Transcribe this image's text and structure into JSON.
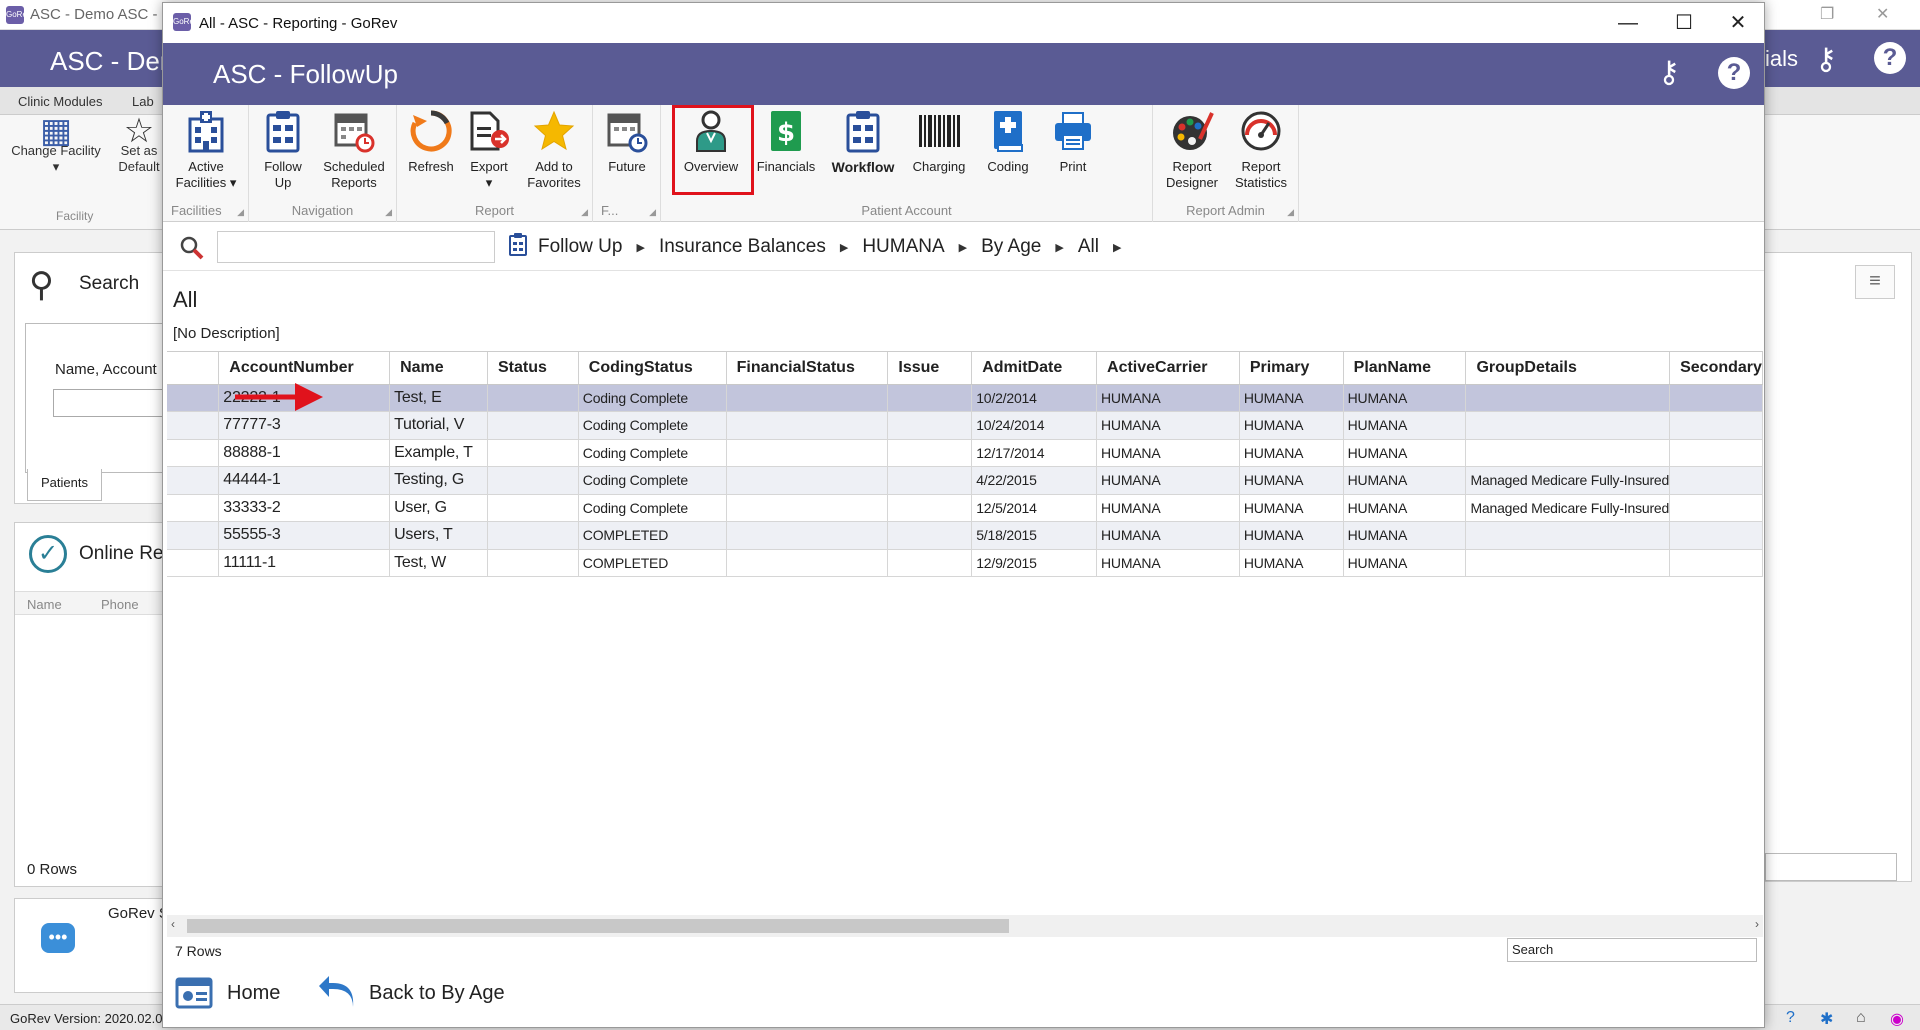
{
  "background_app": {
    "window_title": "ASC - Demo ASC - H",
    "app_icon_text": "GoRev",
    "header_title": "ASC - Der",
    "header_right_text": "ials",
    "tabs": [
      "Clinic Modules",
      "Lab"
    ],
    "ribbon": {
      "change_facility": "Change Facility",
      "set_as_default": "Set as Default",
      "group_label": "Facility"
    },
    "search_panel": {
      "title": "Search",
      "name_label": "Name, Account",
      "tab_label": "Patients"
    },
    "online_panel": {
      "title": "Online Re",
      "columns": [
        "Name",
        "Phone"
      ],
      "rows_text": "0 Rows"
    },
    "chat_panel": {
      "title": "GoRev S"
    },
    "status_bar": {
      "version": "GoRev Version: 2020.02.0"
    }
  },
  "dialog": {
    "window_title": "All - ASC - Reporting - GoRev",
    "app_icon_text": "GoRev",
    "header_title": "ASC - FollowUp",
    "ribbon": {
      "groups": [
        {
          "label": "Facilities",
          "buttons": [
            {
              "label": "Active Facilities ▾",
              "icon": "active-facilities-icon"
            }
          ]
        },
        {
          "label": "Navigation",
          "buttons": [
            {
              "label": "Follow Up",
              "icon": "follow-up-icon"
            },
            {
              "label": "Scheduled Reports",
              "icon": "scheduled-reports-icon"
            }
          ]
        },
        {
          "label": "Report",
          "buttons": [
            {
              "label": "Refresh",
              "icon": "refresh-icon"
            },
            {
              "label": "Export",
              "icon": "export-icon"
            },
            {
              "label": "Add to Favorites",
              "icon": "star-icon"
            }
          ]
        },
        {
          "label": "F...",
          "buttons": [
            {
              "label": "Future",
              "icon": "future-calendar-icon"
            }
          ]
        },
        {
          "label": "Patient Account",
          "buttons": [
            {
              "label": "Overview",
              "icon": "person-icon"
            },
            {
              "label": "Financials",
              "icon": "dollar-icon"
            },
            {
              "label": "Workflow",
              "icon": "clipboard-icon"
            },
            {
              "label": "Charging",
              "icon": "barcode-icon"
            },
            {
              "label": "Coding",
              "icon": "medical-book-icon"
            },
            {
              "label": "Print",
              "icon": "printer-icon"
            }
          ]
        },
        {
          "label": "Report Admin",
          "buttons": [
            {
              "label": "Report Designer",
              "icon": "palette-icon"
            },
            {
              "label": "Report Statistics",
              "icon": "gauge-icon"
            }
          ]
        }
      ]
    },
    "search": {
      "placeholder": ""
    },
    "breadcrumb": [
      "Follow Up",
      "Insurance Balances",
      "HUMANA",
      "By Age",
      "All"
    ],
    "page_title": "All",
    "page_description": "[No Description]",
    "grid": {
      "columns": [
        "AccountNumber",
        "Name",
        "Status",
        "CodingStatus",
        "FinancialStatus",
        "Issue",
        "AdmitDate",
        "ActiveCarrier",
        "Primary",
        "PlanName",
        "GroupDetails",
        "Secondary"
      ],
      "rows": [
        [
          "22222-1",
          "Test, E",
          "",
          "Coding Complete",
          "",
          "",
          "10/2/2014",
          "HUMANA",
          "HUMANA",
          "HUMANA",
          "",
          ""
        ],
        [
          "77777-3",
          "Tutorial, V",
          "",
          "Coding Complete",
          "",
          "",
          "10/24/2014",
          "HUMANA",
          "HUMANA",
          "HUMANA",
          "",
          ""
        ],
        [
          "88888-1",
          "Example, T",
          "",
          "Coding Complete",
          "",
          "",
          "12/17/2014",
          "HUMANA",
          "HUMANA",
          "HUMANA",
          "",
          ""
        ],
        [
          "44444-1",
          "Testing, G",
          "",
          "Coding Complete",
          "",
          "",
          "4/22/2015",
          "HUMANA",
          "HUMANA",
          "HUMANA",
          "Managed Medicare Fully-Insured",
          ""
        ],
        [
          "33333-2",
          "User, G",
          "",
          "Coding Complete",
          "",
          "",
          "12/5/2014",
          "HUMANA",
          "HUMANA",
          "HUMANA",
          "Managed Medicare Fully-Insured",
          ""
        ],
        [
          "55555-3",
          "Users, T",
          "",
          "COMPLETED",
          "",
          "",
          "5/18/2015",
          "HUMANA",
          "HUMANA",
          "HUMANA",
          "",
          ""
        ],
        [
          "11111-1",
          "Test, W",
          "",
          "COMPLETED",
          "",
          "",
          "12/9/2015",
          "HUMANA",
          "HUMANA",
          "HUMANA",
          "",
          ""
        ]
      ],
      "selected_row": 0,
      "rows_text": "7 Rows",
      "search_label": "Search"
    },
    "footer": {
      "home_label": "Home",
      "back_label": "Back to By Age"
    }
  },
  "colors": {
    "header_bg": "#5a5b94",
    "selected_row": "#c2c5dc",
    "alt_row": "#eef0f5",
    "highlight": "#e0121c"
  }
}
